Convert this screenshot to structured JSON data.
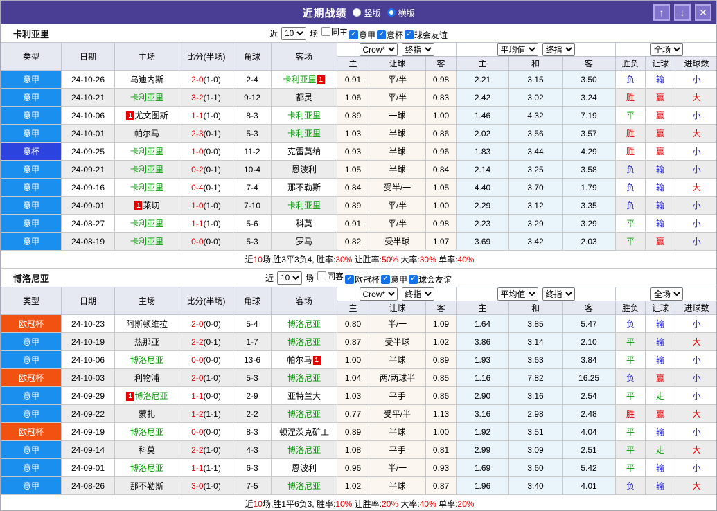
{
  "titlebar": {
    "title": "近期战绩",
    "radios": [
      {
        "label": "竖版",
        "checked": false
      },
      {
        "label": "横版",
        "checked": true
      }
    ],
    "buttons": [
      {
        "name": "scroll-up",
        "glyph": "↑"
      },
      {
        "name": "scroll-down",
        "glyph": "↓"
      },
      {
        "name": "close",
        "glyph": "✕"
      }
    ]
  },
  "header": {
    "base_columns": [
      "类型",
      "日期",
      "主场",
      "比分(半场)",
      "角球",
      "客场"
    ],
    "odds_group": {
      "selects": [
        "Crow*",
        "终指"
      ],
      "columns": [
        "主",
        "让球",
        "客"
      ]
    },
    "avg_group": {
      "selects": [
        "平均值",
        "终指"
      ],
      "columns": [
        "主",
        "和",
        "客"
      ]
    },
    "full_group": {
      "selects": [
        "全场"
      ],
      "columns": [
        "胜负",
        "让球",
        "进球数"
      ]
    }
  },
  "colors": {
    "titlebar_bg": "#4a3d94",
    "type_colors": {
      "意甲": "#1a8fee",
      "意杯": "#2d43dd",
      "欧冠杯": "#f25211"
    },
    "result_map": {
      "胜": "red",
      "赢": "red",
      "大": "red",
      "平": "green",
      "走": "green",
      "负": "blue",
      "输": "blue",
      "小": "blue"
    },
    "result_colors": {
      "red": "#e60000",
      "green": "#009900",
      "blue": "#2b2bd5"
    },
    "team_green": "#009900",
    "score_red": "#e60000"
  },
  "tables": [
    {
      "team": "卡利亚里",
      "filter": {
        "prefix": "近",
        "count": "10",
        "suffix": "场",
        "checkboxes": [
          {
            "label": "同主",
            "checked": false
          },
          {
            "label": "意甲",
            "checked": true
          },
          {
            "label": "意杯",
            "checked": true
          },
          {
            "label": "球会友谊",
            "checked": true
          }
        ]
      },
      "rows": [
        {
          "type": "意甲",
          "date": "24-10-26",
          "home": {
            "name": "乌迪内斯"
          },
          "score": "2-0",
          "half": "(1-0)",
          "corner": "2-4",
          "away": {
            "name": "卡利亚里",
            "green": true,
            "card": "1",
            "card_pos": "right"
          },
          "odds": [
            "0.91",
            "平/半",
            "0.98"
          ],
          "avg": [
            "2.21",
            "3.15",
            "3.50"
          ],
          "result": [
            "负",
            "输",
            "小"
          ]
        },
        {
          "type": "意甲",
          "date": "24-10-21",
          "home": {
            "name": "卡利亚里",
            "green": true
          },
          "score": "3-2",
          "half": "(1-1)",
          "corner": "9-12",
          "away": {
            "name": "都灵"
          },
          "odds": [
            "1.06",
            "平/半",
            "0.83"
          ],
          "avg": [
            "2.42",
            "3.02",
            "3.24"
          ],
          "result": [
            "胜",
            "赢",
            "大"
          ]
        },
        {
          "type": "意甲",
          "date": "24-10-06",
          "home": {
            "name": "尤文图斯",
            "card": "1",
            "card_pos": "left"
          },
          "score": "1-1",
          "half": "(1-0)",
          "corner": "8-3",
          "away": {
            "name": "卡利亚里",
            "green": true
          },
          "odds": [
            "0.89",
            "一球",
            "1.00"
          ],
          "avg": [
            "1.46",
            "4.32",
            "7.19"
          ],
          "result": [
            "平",
            "赢",
            "小"
          ]
        },
        {
          "type": "意甲",
          "date": "24-10-01",
          "home": {
            "name": "帕尔马"
          },
          "score": "2-3",
          "half": "(0-1)",
          "corner": "5-3",
          "away": {
            "name": "卡利亚里",
            "green": true
          },
          "odds": [
            "1.03",
            "半球",
            "0.86"
          ],
          "avg": [
            "2.02",
            "3.56",
            "3.57"
          ],
          "result": [
            "胜",
            "赢",
            "大"
          ]
        },
        {
          "type": "意杯",
          "date": "24-09-25",
          "home": {
            "name": "卡利亚里",
            "green": true
          },
          "score": "1-0",
          "half": "(0-0)",
          "corner": "11-2",
          "away": {
            "name": "克雷莫纳"
          },
          "odds": [
            "0.93",
            "半球",
            "0.96"
          ],
          "avg": [
            "1.83",
            "3.44",
            "4.29"
          ],
          "result": [
            "胜",
            "赢",
            "小"
          ]
        },
        {
          "type": "意甲",
          "date": "24-09-21",
          "home": {
            "name": "卡利亚里",
            "green": true
          },
          "score": "0-2",
          "half": "(0-1)",
          "corner": "10-4",
          "away": {
            "name": "恩波利"
          },
          "odds": [
            "1.05",
            "半球",
            "0.84"
          ],
          "avg": [
            "2.14",
            "3.25",
            "3.58"
          ],
          "result": [
            "负",
            "输",
            "小"
          ]
        },
        {
          "type": "意甲",
          "date": "24-09-16",
          "home": {
            "name": "卡利亚里",
            "green": true
          },
          "score": "0-4",
          "half": "(0-1)",
          "corner": "7-4",
          "away": {
            "name": "那不勒斯"
          },
          "odds": [
            "0.84",
            "受半/一",
            "1.05"
          ],
          "avg": [
            "4.40",
            "3.70",
            "1.79"
          ],
          "result": [
            "负",
            "输",
            "大"
          ]
        },
        {
          "type": "意甲",
          "date": "24-09-01",
          "home": {
            "name": "莱切",
            "card": "1",
            "card_pos": "left"
          },
          "score": "1-0",
          "half": "(1-0)",
          "corner": "7-10",
          "away": {
            "name": "卡利亚里",
            "green": true
          },
          "odds": [
            "0.89",
            "平/半",
            "1.00"
          ],
          "avg": [
            "2.29",
            "3.12",
            "3.35"
          ],
          "result": [
            "负",
            "输",
            "小"
          ]
        },
        {
          "type": "意甲",
          "date": "24-08-27",
          "home": {
            "name": "卡利亚里",
            "green": true
          },
          "score": "1-1",
          "half": "(1-0)",
          "corner": "5-6",
          "away": {
            "name": "科莫"
          },
          "odds": [
            "0.91",
            "平/半",
            "0.98"
          ],
          "avg": [
            "2.23",
            "3.29",
            "3.29"
          ],
          "result": [
            "平",
            "输",
            "小"
          ]
        },
        {
          "type": "意甲",
          "date": "24-08-19",
          "home": {
            "name": "卡利亚里",
            "green": true
          },
          "score": "0-0",
          "half": "(0-0)",
          "corner": "5-3",
          "away": {
            "name": "罗马"
          },
          "odds": [
            "0.82",
            "受半球",
            "1.07"
          ],
          "avg": [
            "3.69",
            "3.42",
            "2.03"
          ],
          "result": [
            "平",
            "赢",
            "小"
          ]
        }
      ],
      "summary": {
        "parts": [
          {
            "text": "近",
            "red": false
          },
          {
            "text": "10",
            "red": true
          },
          {
            "text": "场,胜3平3负4, 胜率:",
            "red": false
          },
          {
            "text": "30%",
            "red": true
          },
          {
            "text": " 让胜率:",
            "red": false
          },
          {
            "text": "50%",
            "red": true
          },
          {
            "text": " 大率:",
            "red": false
          },
          {
            "text": "30%",
            "red": true
          },
          {
            "text": " 单率:",
            "red": false
          },
          {
            "text": "40%",
            "red": true
          }
        ]
      }
    },
    {
      "team": "博洛尼亚",
      "filter": {
        "prefix": "近",
        "count": "10",
        "suffix": "场",
        "checkboxes": [
          {
            "label": "同客",
            "checked": false
          },
          {
            "label": "欧冠杯",
            "checked": true
          },
          {
            "label": "意甲",
            "checked": true
          },
          {
            "label": "球会友谊",
            "checked": true
          }
        ]
      },
      "rows": [
        {
          "type": "欧冠杯",
          "date": "24-10-23",
          "home": {
            "name": "阿斯顿维拉"
          },
          "score": "2-0",
          "half": "(0-0)",
          "corner": "5-4",
          "away": {
            "name": "博洛尼亚",
            "green": true
          },
          "odds": [
            "0.80",
            "半/一",
            "1.09"
          ],
          "avg": [
            "1.64",
            "3.85",
            "5.47"
          ],
          "result": [
            "负",
            "输",
            "小"
          ]
        },
        {
          "type": "意甲",
          "date": "24-10-19",
          "home": {
            "name": "热那亚"
          },
          "score": "2-2",
          "half": "(0-1)",
          "corner": "1-7",
          "away": {
            "name": "博洛尼亚",
            "green": true
          },
          "odds": [
            "0.87",
            "受半球",
            "1.02"
          ],
          "avg": [
            "3.86",
            "3.14",
            "2.10"
          ],
          "result": [
            "平",
            "输",
            "大"
          ]
        },
        {
          "type": "意甲",
          "date": "24-10-06",
          "home": {
            "name": "博洛尼亚",
            "green": true
          },
          "score": "0-0",
          "half": "(0-0)",
          "corner": "13-6",
          "away": {
            "name": "帕尔马",
            "card": "1",
            "card_pos": "right"
          },
          "odds": [
            "1.00",
            "半球",
            "0.89"
          ],
          "avg": [
            "1.93",
            "3.63",
            "3.84"
          ],
          "result": [
            "平",
            "输",
            "小"
          ]
        },
        {
          "type": "欧冠杯",
          "date": "24-10-03",
          "home": {
            "name": "利物浦"
          },
          "score": "2-0",
          "half": "(1-0)",
          "corner": "5-3",
          "away": {
            "name": "博洛尼亚",
            "green": true
          },
          "odds": [
            "1.04",
            "两/两球半",
            "0.85"
          ],
          "avg": [
            "1.16",
            "7.82",
            "16.25"
          ],
          "result": [
            "负",
            "赢",
            "小"
          ]
        },
        {
          "type": "意甲",
          "date": "24-09-29",
          "home": {
            "name": "博洛尼亚",
            "green": true,
            "card": "1",
            "card_pos": "left"
          },
          "score": "1-1",
          "half": "(0-0)",
          "corner": "2-9",
          "away": {
            "name": "亚特兰大"
          },
          "odds": [
            "1.03",
            "平手",
            "0.86"
          ],
          "avg": [
            "2.90",
            "3.16",
            "2.54"
          ],
          "result": [
            "平",
            "走",
            "小"
          ]
        },
        {
          "type": "意甲",
          "date": "24-09-22",
          "home": {
            "name": "蒙扎"
          },
          "score": "1-2",
          "half": "(1-1)",
          "corner": "2-2",
          "away": {
            "name": "博洛尼亚",
            "green": true
          },
          "odds": [
            "0.77",
            "受平/半",
            "1.13"
          ],
          "avg": [
            "3.16",
            "2.98",
            "2.48"
          ],
          "result": [
            "胜",
            "赢",
            "大"
          ]
        },
        {
          "type": "欧冠杯",
          "date": "24-09-19",
          "home": {
            "name": "博洛尼亚",
            "green": true
          },
          "score": "0-0",
          "half": "(0-0)",
          "corner": "8-3",
          "away": {
            "name": "顿涅茨克矿工"
          },
          "odds": [
            "0.89",
            "半球",
            "1.00"
          ],
          "avg": [
            "1.92",
            "3.51",
            "4.04"
          ],
          "result": [
            "平",
            "输",
            "小"
          ]
        },
        {
          "type": "意甲",
          "date": "24-09-14",
          "home": {
            "name": "科莫"
          },
          "score": "2-2",
          "half": "(1-0)",
          "corner": "4-3",
          "away": {
            "name": "博洛尼亚",
            "green": true
          },
          "odds": [
            "1.08",
            "平手",
            "0.81"
          ],
          "avg": [
            "2.99",
            "3.09",
            "2.51"
          ],
          "result": [
            "平",
            "走",
            "大"
          ]
        },
        {
          "type": "意甲",
          "date": "24-09-01",
          "home": {
            "name": "博洛尼亚",
            "green": true
          },
          "score": "1-1",
          "half": "(1-1)",
          "corner": "6-3",
          "away": {
            "name": "恩波利"
          },
          "odds": [
            "0.96",
            "半/一",
            "0.93"
          ],
          "avg": [
            "1.69",
            "3.60",
            "5.42"
          ],
          "result": [
            "平",
            "输",
            "小"
          ]
        },
        {
          "type": "意甲",
          "date": "24-08-26",
          "home": {
            "name": "那不勒斯"
          },
          "score": "3-0",
          "half": "(1-0)",
          "corner": "7-5",
          "away": {
            "name": "博洛尼亚",
            "green": true
          },
          "odds": [
            "1.02",
            "半球",
            "0.87"
          ],
          "avg": [
            "1.96",
            "3.40",
            "4.01"
          ],
          "result": [
            "负",
            "输",
            "大"
          ]
        }
      ],
      "summary": {
        "parts": [
          {
            "text": "近",
            "red": false
          },
          {
            "text": "10",
            "red": true
          },
          {
            "text": "场,胜1平6负3, 胜率:",
            "red": false
          },
          {
            "text": "10%",
            "red": true
          },
          {
            "text": " 让胜率:",
            "red": false
          },
          {
            "text": "20%",
            "red": true
          },
          {
            "text": " 大率:",
            "red": false
          },
          {
            "text": "40%",
            "red": true
          },
          {
            "text": " 单率:",
            "red": false
          },
          {
            "text": "20%",
            "red": true
          }
        ]
      }
    }
  ]
}
